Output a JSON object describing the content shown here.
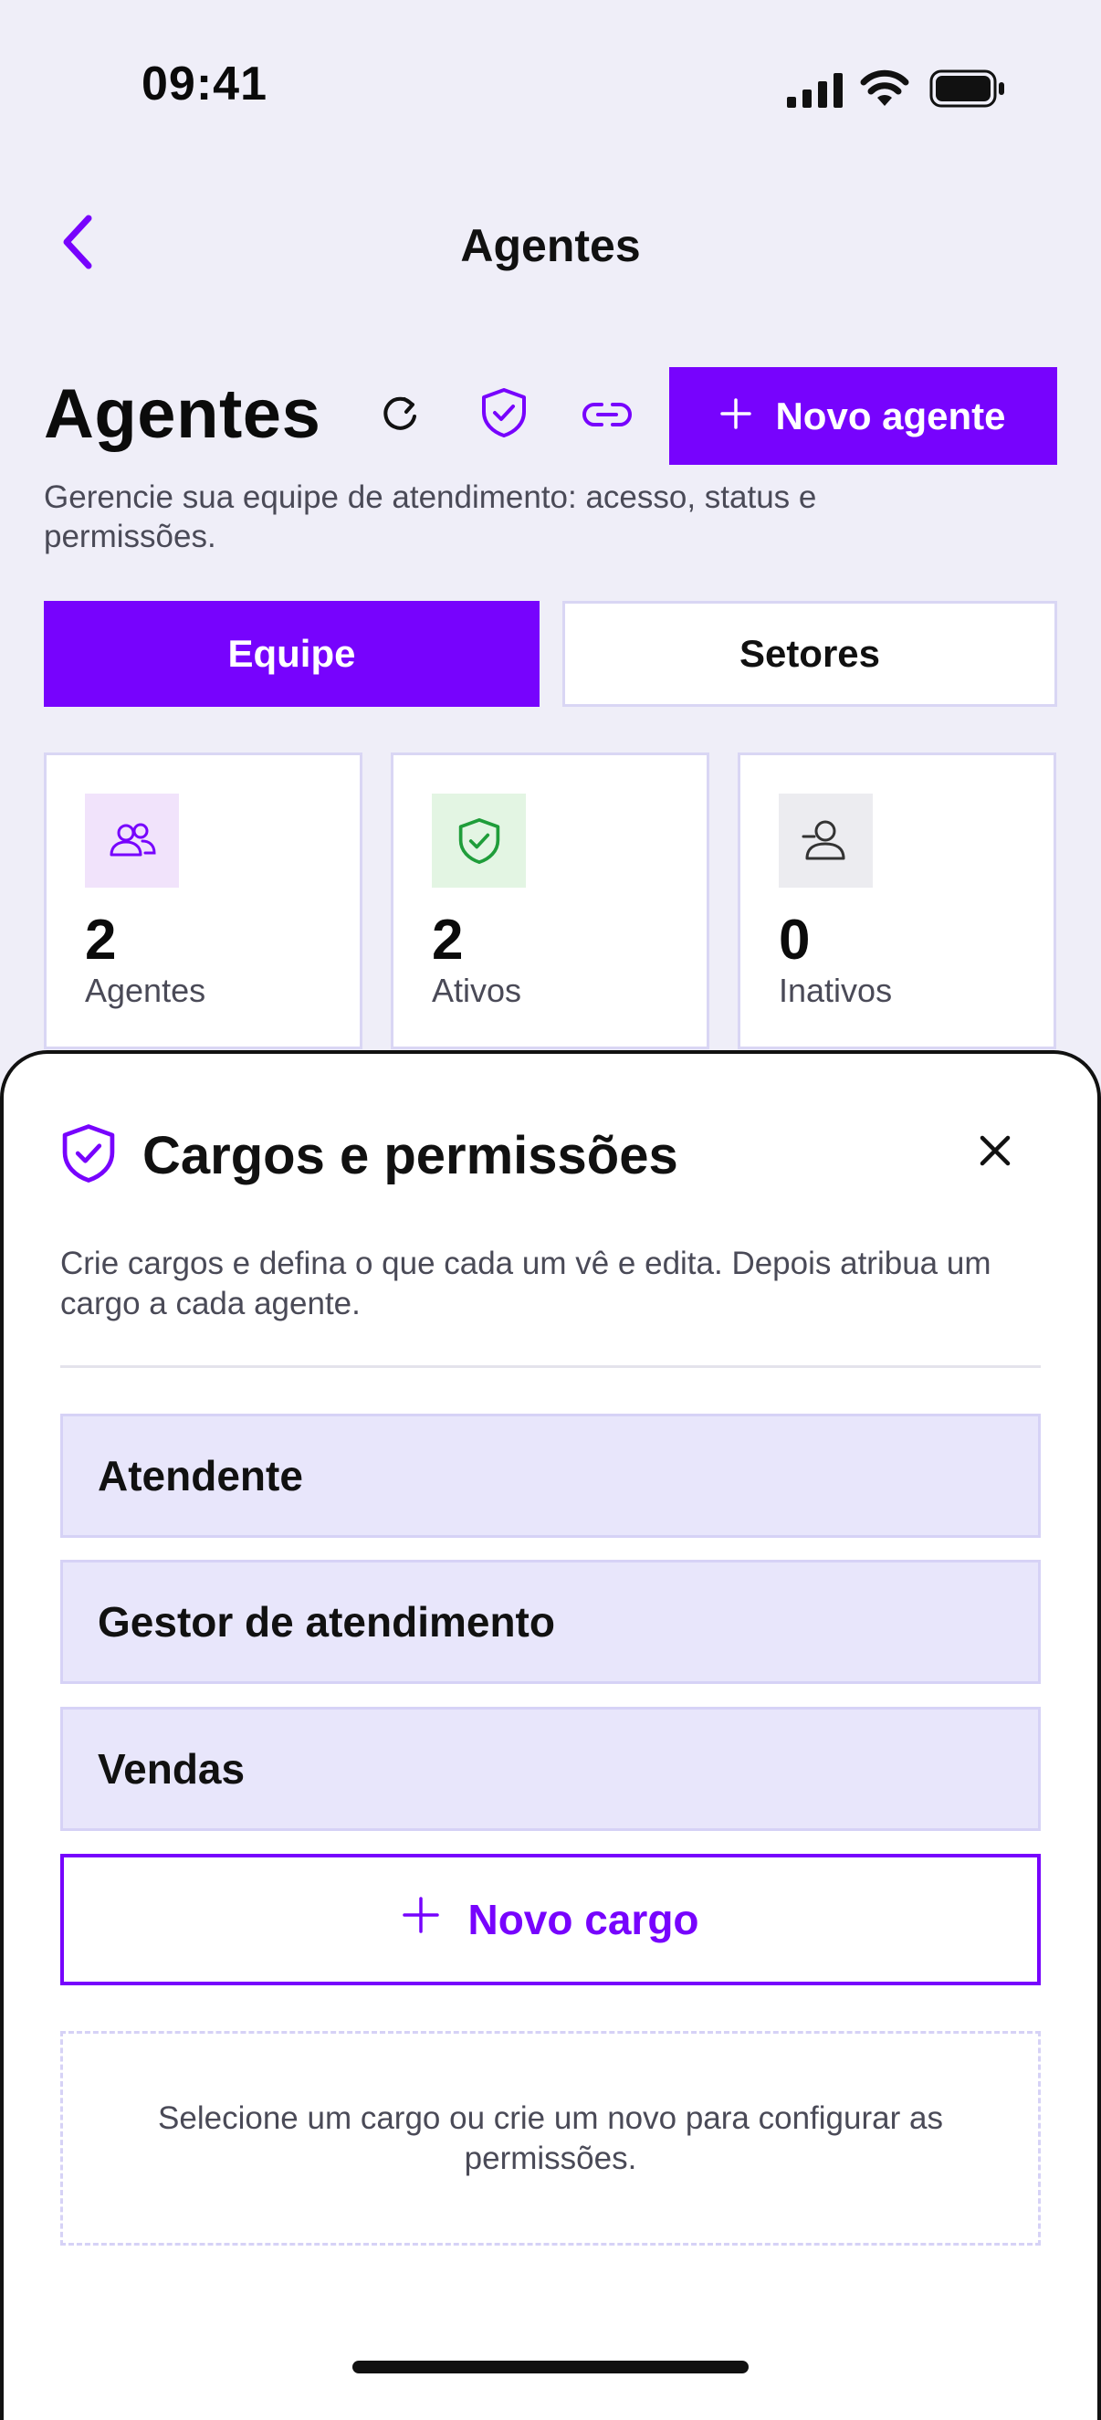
{
  "status_bar": {
    "time": "09:41"
  },
  "nav": {
    "title": "Agentes"
  },
  "header": {
    "title": "Agentes",
    "subtitle": "Gerencie sua equipe de atendimento: acesso, status e permissões.",
    "new_agent_label": "Novo agente"
  },
  "segments": {
    "equipe": "Equipe",
    "setores": "Setores",
    "active": "Equipe"
  },
  "stats": [
    {
      "value": "2",
      "label": "Agentes",
      "icon": "users-icon"
    },
    {
      "value": "2",
      "label": "Ativos",
      "icon": "shield-check-icon"
    },
    {
      "value": "0",
      "label": "Inativos",
      "icon": "user-minus-icon"
    }
  ],
  "sheet": {
    "title": "Cargos e permissões",
    "description": "Crie cargos e defina o que cada um vê e edita. Depois atribua um cargo a cada agente.",
    "roles": [
      "Atendente",
      "Gestor de atendimento",
      "Vendas"
    ],
    "new_role_label": "Novo cargo",
    "empty_message": "Selecione um cargo ou crie um novo para configurar as permissões."
  },
  "colors": {
    "accent": "#7703fd",
    "background": "#efeef8",
    "role_bg": "#e8e6fb",
    "active_green": "#1f9d3a"
  }
}
